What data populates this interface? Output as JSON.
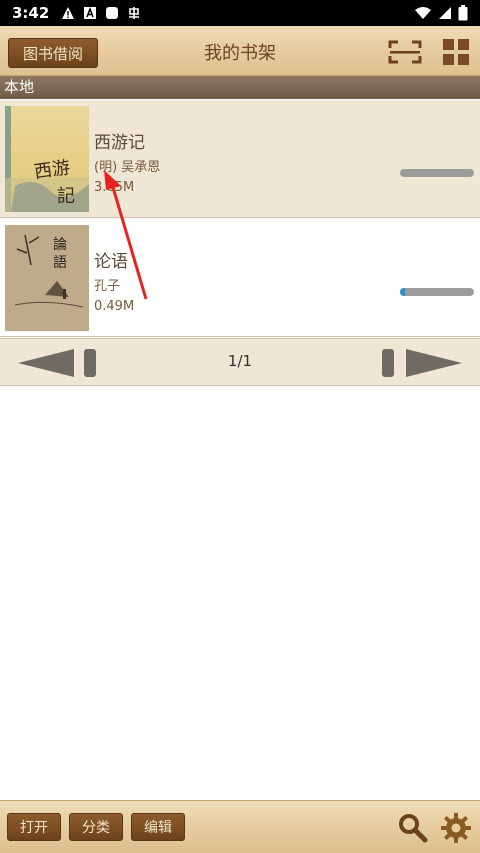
{
  "status_bar": {
    "time": "3:42"
  },
  "toolbar": {
    "borrow_label": "图书借阅",
    "title": "我的书架"
  },
  "section": {
    "label": "本地"
  },
  "books": [
    {
      "title": "西游记",
      "author": "(明) 吴承恩",
      "size": "3.05M",
      "progress": 0.0,
      "cover_text": "西游记"
    },
    {
      "title": "论语",
      "author": "孔子",
      "size": "0.49M",
      "progress": 0.05,
      "cover_text": "论语"
    }
  ],
  "pager": {
    "page": "1/1"
  },
  "bottom": {
    "open_label": "打开",
    "category_label": "分类",
    "edit_label": "编辑"
  },
  "colors": {
    "wood_light": "#eedcb8",
    "button_brown": "#7a4b20",
    "accent_blue": "#2b8fd0",
    "annotation_red": "#e8231d"
  },
  "icons": {
    "scan": "scan-icon",
    "grid": "grid-view-icon",
    "search": "search-icon",
    "settings": "gear-icon"
  }
}
